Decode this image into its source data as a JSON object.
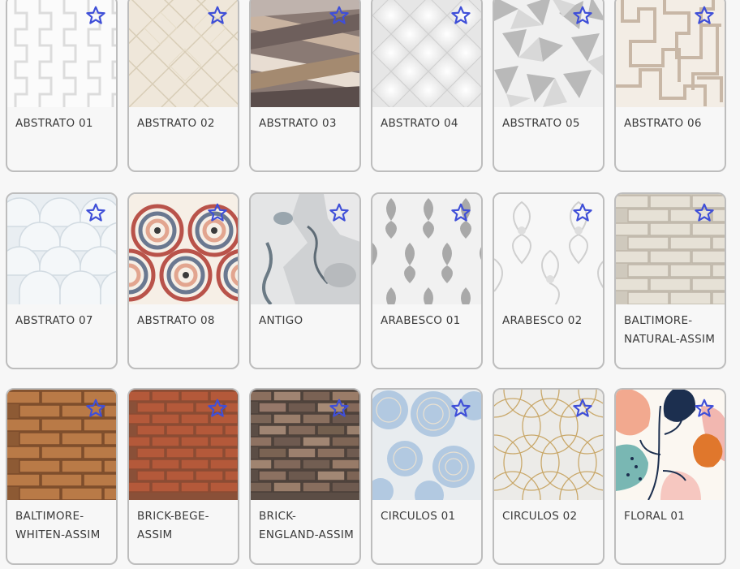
{
  "favorite_icon": "star-outline-icon",
  "accent_color": "#3f4fd8",
  "patterns": [
    {
      "label": "ABSTRATO 01",
      "texture": "abstrato-01-wave"
    },
    {
      "label": "ABSTRATO 02",
      "texture": "abstrato-02-diamond"
    },
    {
      "label": "ABSTRATO 03",
      "texture": "abstrato-03-bands"
    },
    {
      "label": "ABSTRATO 04",
      "texture": "abstrato-04-quilted"
    },
    {
      "label": "ABSTRATO 05",
      "texture": "abstrato-05-triangles"
    },
    {
      "label": "ABSTRATO 06",
      "texture": "abstrato-06-maze"
    },
    {
      "label": "ABSTRATO 07",
      "texture": "abstrato-07-scales"
    },
    {
      "label": "ABSTRATO 08",
      "texture": "abstrato-08-fans"
    },
    {
      "label": "ANTIGO",
      "texture": "antigo-concrete"
    },
    {
      "label": "ARABESCO 01",
      "texture": "arabesco-01-damask"
    },
    {
      "label": "ARABESCO 02",
      "texture": "arabesco-02-damask"
    },
    {
      "label": "BALTIMORE-NATURAL-ASSIM",
      "texture": "baltimore-natural-brick"
    },
    {
      "label": "BALTIMORE-WHITEN-ASSIM",
      "texture": "baltimore-whiten-brick"
    },
    {
      "label": "BRICK-BEGE-ASSIM",
      "texture": "brick-bege"
    },
    {
      "label": "BRICK-ENGLAND-ASSIM",
      "texture": "brick-england"
    },
    {
      "label": "CIRCULOS 01",
      "texture": "circulos-01"
    },
    {
      "label": "CIRCULOS 02",
      "texture": "circulos-02"
    },
    {
      "label": "FLORAL 01",
      "texture": "floral-01"
    }
  ]
}
